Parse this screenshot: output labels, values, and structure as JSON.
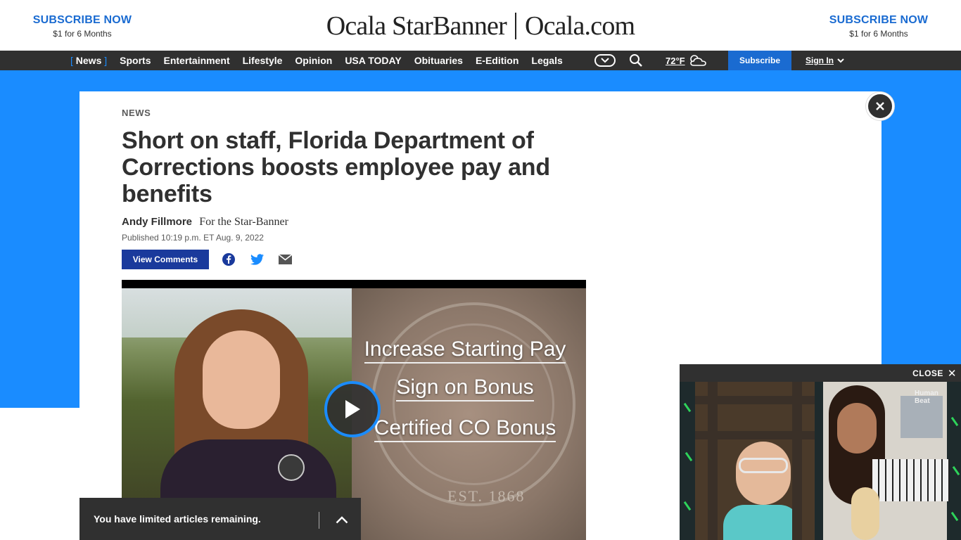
{
  "header": {
    "subscribe_left": {
      "title": "SUBSCRIBE NOW",
      "subtitle": "$1 for 6 Months"
    },
    "subscribe_right": {
      "title": "SUBSCRIBE NOW",
      "subtitle": "$1 for 6 Months"
    },
    "logo_left": "Ocala StarBanner",
    "logo_right": "Ocala.com"
  },
  "nav": {
    "items": [
      {
        "label": "News",
        "active": true
      },
      {
        "label": "Sports"
      },
      {
        "label": "Entertainment"
      },
      {
        "label": "Lifestyle"
      },
      {
        "label": "Opinion"
      },
      {
        "label": "USA TODAY"
      },
      {
        "label": "Obituaries"
      },
      {
        "label": "E-Edition"
      },
      {
        "label": "Legals"
      }
    ],
    "active_bracket_open": "[",
    "active_bracket_close": "]",
    "temperature": "72°F",
    "subscribe": "Subscribe",
    "sign_in": "Sign In"
  },
  "article": {
    "section": "NEWS",
    "headline": "Short on staff, Florida Department of Corrections boosts employee pay and benefits",
    "author": "Andy Fillmore",
    "affiliation": "For the Star-Banner",
    "published": "Published 10:19 p.m. ET Aug. 9, 2022",
    "view_comments": "View Comments"
  },
  "video": {
    "lines": [
      "Increase Starting Pay",
      "Sign on Bonus",
      "Certified CO Bonus"
    ],
    "seal_text": "EST. 1868"
  },
  "limited_bar": {
    "message": "You have limited articles remaining."
  },
  "sticky_video": {
    "close_label": "CLOSE",
    "close_x": "✕",
    "corner_label_1": "Human",
    "corner_label_2": "Beat"
  },
  "colors": {
    "brand_blue": "#1a8cff",
    "link_blue": "#1a6bd1",
    "nav_dark": "#303030",
    "comments_blue": "#1a3a9c"
  },
  "icons": {
    "close": "close-icon",
    "search": "search-icon",
    "weather": "partly-cloudy-icon",
    "facebook": "facebook-icon",
    "twitter": "twitter-icon",
    "email": "email-icon",
    "play": "play-icon",
    "chevron_up": "chevron-up-icon",
    "chevron_down": "chevron-down-icon"
  }
}
